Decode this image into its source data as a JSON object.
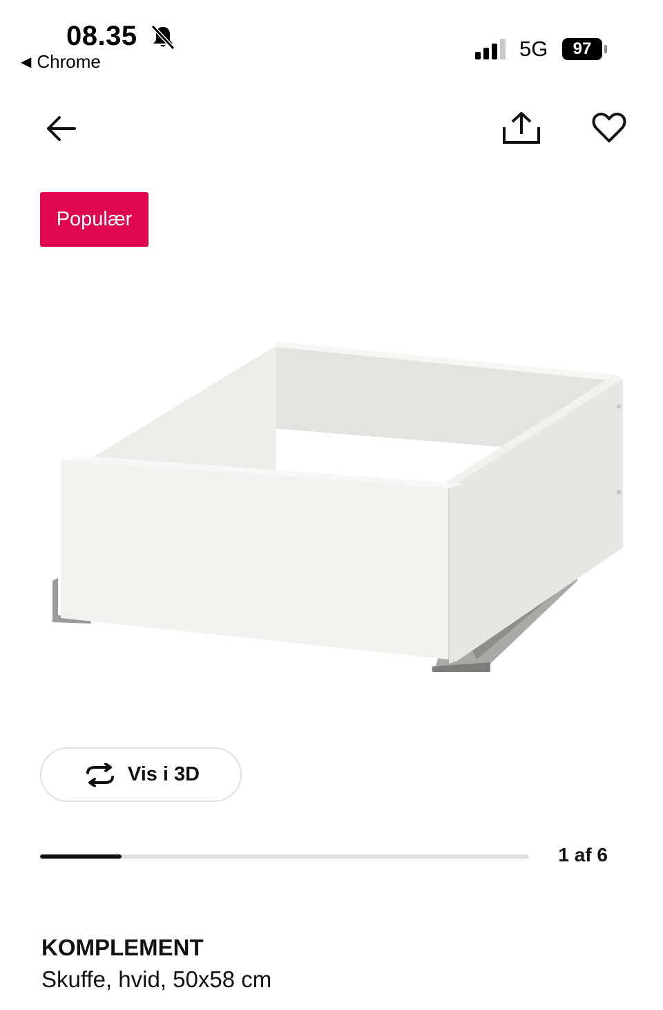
{
  "status_bar": {
    "time": "08.35",
    "back_app": "Chrome",
    "network": "5G",
    "battery": "97"
  },
  "nav": {
    "back_icon": "arrow-left-icon",
    "share_icon": "share-icon",
    "favorite_icon": "heart-icon"
  },
  "badge": {
    "label": "Populær",
    "color": "#e00751"
  },
  "viewer": {
    "button_3d_label": "Vis i 3D",
    "rotate_icon": "rotate-3d-icon"
  },
  "gallery": {
    "current": 1,
    "total": 6,
    "label": "1 af 6"
  },
  "product": {
    "name": "KOMPLEMENT",
    "description": "Skuffe, hvid, 50x58 cm"
  }
}
